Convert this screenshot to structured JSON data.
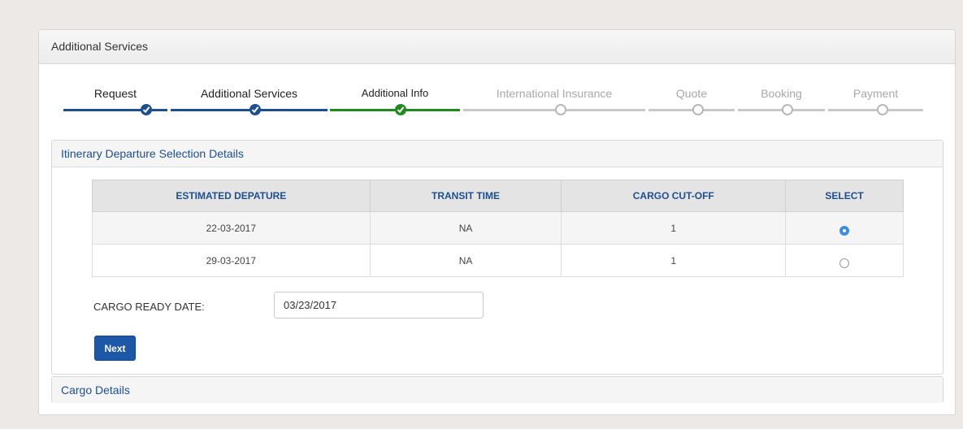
{
  "outer": {
    "title": "Additional Services"
  },
  "wizard": {
    "steps": [
      {
        "label": "Request",
        "state": "done"
      },
      {
        "label": "Additional Services",
        "state": "done"
      },
      {
        "label": "Additional Info",
        "state": "current"
      },
      {
        "label": "International Insurance",
        "state": "todo"
      },
      {
        "label": "Quote",
        "state": "todo"
      },
      {
        "label": "Booking",
        "state": "todo"
      },
      {
        "label": "Payment",
        "state": "todo"
      }
    ]
  },
  "itinerary": {
    "title": "Itinerary Departure Selection Details",
    "columns": [
      "ESTIMATED DEPATURE",
      "TRANSIT TIME",
      "CARGO CUT-OFF",
      "SELECT"
    ],
    "rows": [
      {
        "departure": "22-03-2017",
        "transit": "NA",
        "cutoff": "1",
        "selected": true
      },
      {
        "departure": "29-03-2017",
        "transit": "NA",
        "cutoff": "1",
        "selected": false
      }
    ],
    "cargo_ready_label": "CARGO READY DATE:",
    "cargo_ready_value": "03/23/2017",
    "next_label": "Next"
  },
  "cargo": {
    "title": "Cargo Details"
  },
  "colors": {
    "done": "#1d4f8f",
    "current": "#1f8a1f",
    "todo": "#c8c8c8",
    "accent_button": "#1d57a8"
  }
}
